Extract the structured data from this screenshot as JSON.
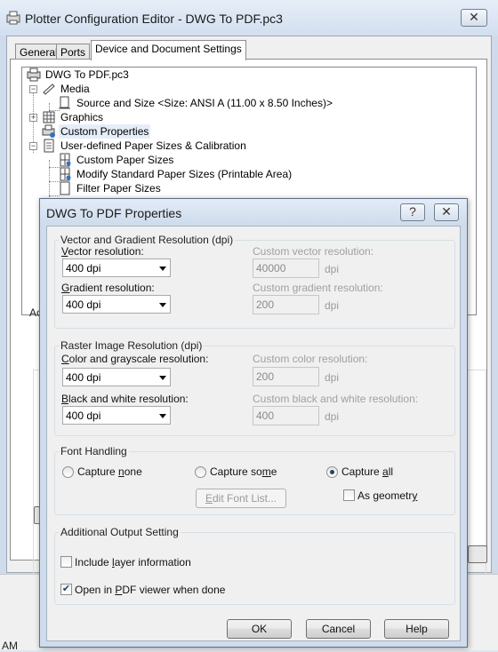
{
  "outer": {
    "title": "Plotter Configuration Editor - DWG To PDF.pc3",
    "close_glyph": "✕",
    "tabs": [
      "General",
      "Ports",
      "Device and Document Settings"
    ],
    "tree": {
      "root": "DWG To PDF.pc3",
      "media": "Media",
      "source_size": "Source and Size <Size: ANSI A (11.00 x 8.50 Inches)>",
      "graphics": "Graphics",
      "custom_properties": "Custom Properties",
      "user_defined": "User-defined Paper Sizes & Calibration",
      "custom_paper": "Custom Paper Sizes",
      "modify_standard": "Modify Standard Paper Sizes (Printable Area)",
      "filter_paper": "Filter Paper Sizes"
    },
    "partial_label": "Ac",
    "taskbar_text": "AM"
  },
  "dialog": {
    "title": "DWG To PDF Properties",
    "help_glyph": "?",
    "close_glyph": "✕",
    "vector_group": {
      "title": "Vector and Gradient Resolution (dpi)",
      "vector_label_u": "V",
      "vector_label_rest": "ector resolution:",
      "vector_value": "400 dpi",
      "custom_vector_label": "Custom vector resolution:",
      "custom_vector_value": "40000",
      "gradient_label_u": "G",
      "gradient_label_rest": "radient resolution:",
      "gradient_value": "400 dpi",
      "custom_gradient_label": "Custom gradient resolution:",
      "custom_gradient_value": "200",
      "unit": "dpi"
    },
    "raster_group": {
      "title": "Raster Image Resolution (dpi)",
      "color_label_u": "C",
      "color_label_rest": "olor and grayscale resolution:",
      "color_value": "400 dpi",
      "custom_color_label": "Custom color resolution:",
      "custom_color_value": "200",
      "bw_label_u": "B",
      "bw_label_rest": "lack and white resolution:",
      "bw_value": "400 dpi",
      "custom_bw_label": "Custom black and white resolution:",
      "custom_bw_value": "400",
      "unit": "dpi"
    },
    "font_group": {
      "title": "Font Handling",
      "capture_none_a": "Capture ",
      "capture_none_u": "n",
      "capture_none_b": "one",
      "capture_some_a": "Capture so",
      "capture_some_u": "m",
      "capture_some_b": "e",
      "capture_all_a": "Capture ",
      "capture_all_u": "a",
      "capture_all_b": "ll",
      "selected": "Capture all",
      "edit_font_u": "E",
      "edit_font_rest": "dit Font List...",
      "as_geometry_a": "As geometr",
      "as_geometry_u": "y",
      "as_geometry_checked": false
    },
    "additional_group": {
      "title": "Additional Output Setting",
      "layer_a": "Include ",
      "layer_u": "l",
      "layer_b": "ayer information",
      "layer_checked": false,
      "viewer_a": "Open in ",
      "viewer_u": "P",
      "viewer_b": "DF viewer when done",
      "viewer_checked": true,
      "check_glyph": "✔"
    },
    "buttons": {
      "ok": "OK",
      "cancel": "Cancel",
      "help": "Help"
    }
  }
}
